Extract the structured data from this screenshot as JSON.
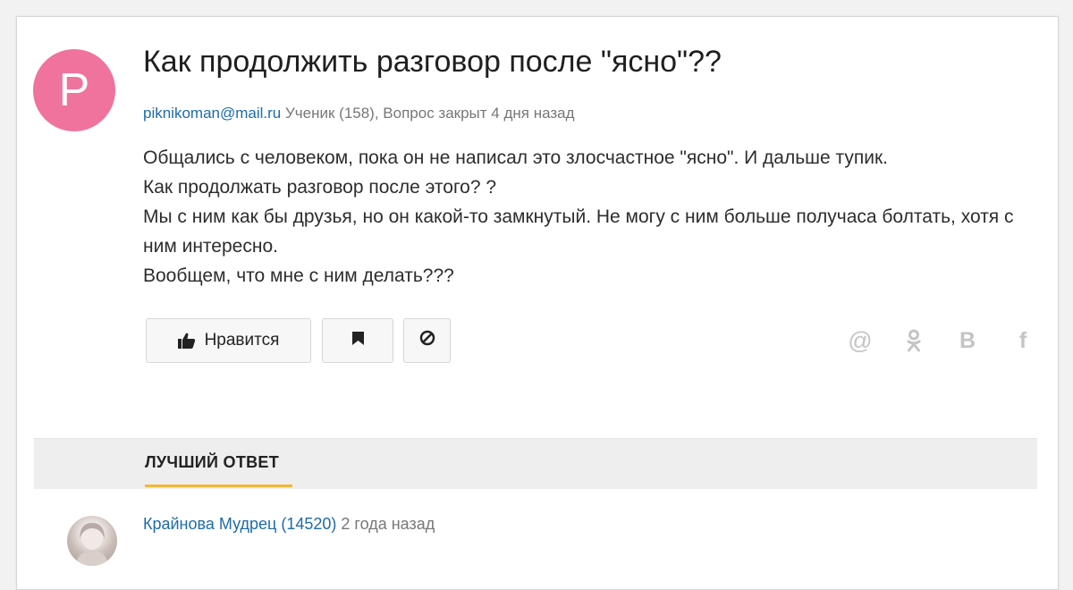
{
  "question": {
    "avatar_letter": "P",
    "avatar_color": "#f0739d",
    "title": "Как продолжить разговор после \"ясно\"??",
    "author": "piknikoman@mail.ru",
    "meta": "Ученик (158), Вопрос закрыт 4 дня назад",
    "body": [
      "Общались с человеком, пока он не написал это злосчастное \"ясно\". И дальше тупик.",
      "Как продолжать разговор после этого? ?",
      "Мы с ним как бы друзья, но он какой-то замкнутый. Не могу с ним больше получаса болтать, хотя с ним интересно.",
      "Вообщем, что мне с ним делать???"
    ]
  },
  "actions": {
    "like_label": "Нравится",
    "like_icon": "thumbs-up-icon",
    "bookmark_icon": "bookmark-icon",
    "block_icon": "block-icon"
  },
  "share": {
    "mail_glyph": "@",
    "ok_glyph": "ok",
    "vk_glyph": "В",
    "fb_glyph": "f"
  },
  "answers": {
    "tab_label": "ЛУЧШИЙ ОТВЕТ",
    "accent_color": "#f5b631",
    "best": {
      "author": "Крайнова",
      "rank": "Мудрец (14520)",
      "time": "2 года назад"
    }
  }
}
